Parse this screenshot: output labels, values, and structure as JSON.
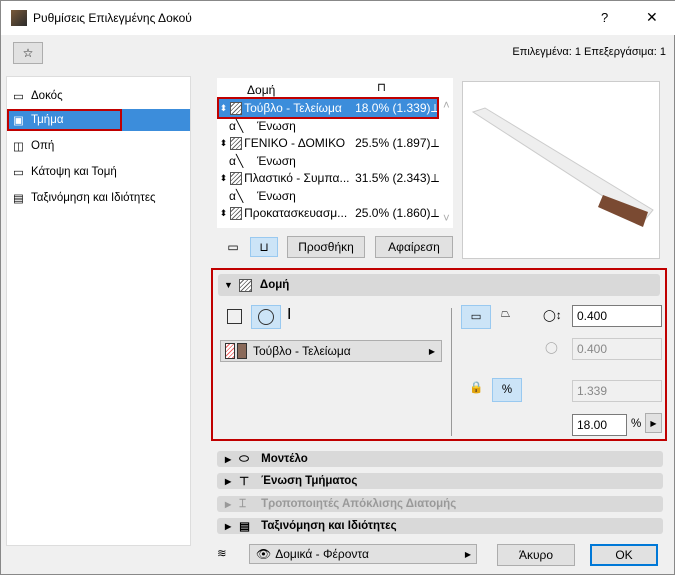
{
  "window": {
    "title": "Ρυθμίσεις Επιλεγμένης Δοκού",
    "help": "?",
    "close": "✕"
  },
  "status": "Επιλεγμένα: 1 Επεξεργάσιμα: 1",
  "sidebar": [
    {
      "label": "Δοκός"
    },
    {
      "label": "Τμήμα"
    },
    {
      "label": "Οπή"
    },
    {
      "label": "Κάτοψη και Τομή"
    },
    {
      "label": "Ταξινόμηση και Ιδιότητες"
    }
  ],
  "table": {
    "header": "Δομή",
    "rows": [
      {
        "type": "segment",
        "name": "Τούβλο - Τελείωμα",
        "value": "18.0% (1.339)",
        "selected": true
      },
      {
        "type": "joint",
        "name": "Ένωση"
      },
      {
        "type": "segment",
        "name": "ΓΕΝΙΚΟ - ΔΟΜΙΚΟ",
        "value": "25.5% (1.897)"
      },
      {
        "type": "joint",
        "name": "Ένωση"
      },
      {
        "type": "segment",
        "name": "Πλαστικό - Συμπα...",
        "value": "31.5% (2.343)"
      },
      {
        "type": "joint",
        "name": "Ένωση"
      },
      {
        "type": "segment",
        "name": "Προκατασκευασμ...",
        "value": "25.0% (1.860)"
      }
    ]
  },
  "buttons": {
    "add": "Προσθήκη",
    "remove": "Αφαίρεση",
    "cancel": "Άκυρο",
    "ok": "OK"
  },
  "structure": {
    "title": "Δομή",
    "material": "Τούβλο - Τελείωμα",
    "width": "0.400",
    "height": "0.400",
    "length": "1.339",
    "percent": "18.00",
    "percent_unit": "%"
  },
  "panels": [
    {
      "label": "Μοντέλο"
    },
    {
      "label": "Ένωση Τμήματος"
    },
    {
      "label": "Τροποποιητές Απόκλισης Διατομής",
      "disabled": true
    },
    {
      "label": "Ταξινόμηση και Ιδιότητες"
    }
  ],
  "layer": "Δομικά - Φέροντα",
  "colors": {
    "accent": "#3c8ddb",
    "highlight": "#c00000",
    "selected_btn": "#cce4f7"
  }
}
